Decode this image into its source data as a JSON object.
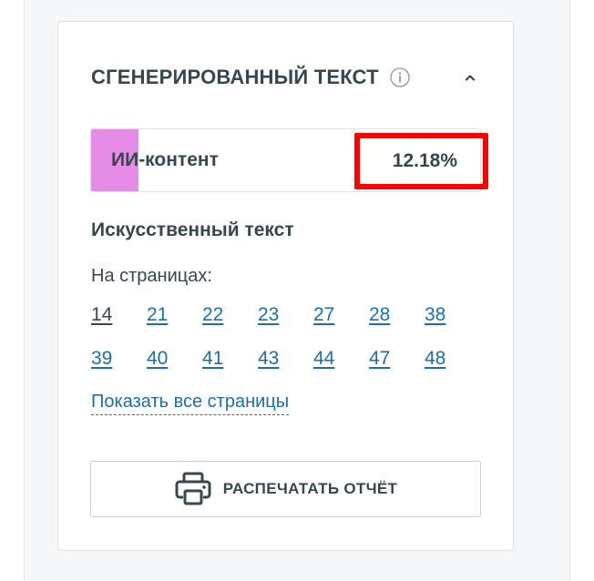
{
  "panel": {
    "title": "СГЕНЕРИРОВАННЫЙ ТЕКСТ",
    "info_icon": "info-icon",
    "collapse_icon": "chevron-up-icon"
  },
  "meter": {
    "label": "ИИ-контент",
    "value": "12.18%",
    "fill_percent": 12.18,
    "fill_color": "#e48ce6",
    "highlight_color": "#ff0000"
  },
  "section": {
    "title": "Искусственный текст",
    "pages_label": "На страницах:",
    "pages": [
      [
        "14",
        "21",
        "22",
        "23",
        "27",
        "28",
        "38"
      ],
      [
        "39",
        "40",
        "41",
        "43",
        "44",
        "47",
        "48"
      ]
    ],
    "show_all": "Показать все страницы"
  },
  "print": {
    "label": "РАСПЕЧАТАТЬ ОТЧЁТ",
    "icon": "printer-icon"
  }
}
